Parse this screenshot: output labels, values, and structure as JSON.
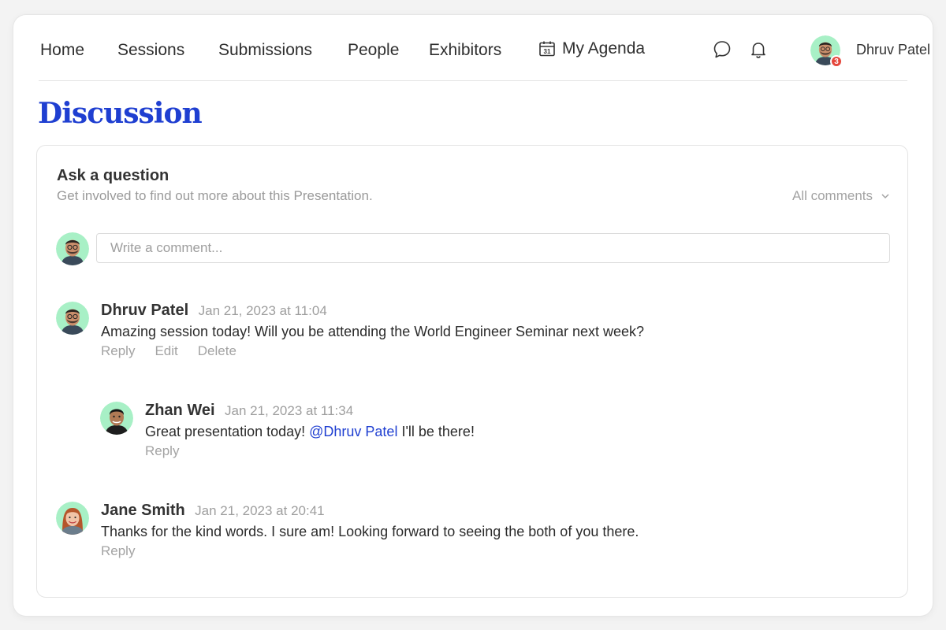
{
  "nav": {
    "links": [
      "Home",
      "Sessions",
      "Submissions",
      "People",
      "Exhibitors"
    ],
    "agenda_label": "My Agenda",
    "agenda_icon": "calendar-icon",
    "agenda_icon_day": "31",
    "chat_icon": "chat-bubble-icon",
    "bell_icon": "bell-icon",
    "notification_count": "3",
    "user_name": "Dhruv Patel"
  },
  "page": {
    "title": "Discussion"
  },
  "discussion": {
    "title": "Ask a question",
    "subtitle": "Get involved to find out more about this Presentation.",
    "filter_label": "All comments",
    "composer": {
      "placeholder": "Write a comment...",
      "value": ""
    },
    "comments": [
      {
        "author": "Dhruv Patel",
        "time": "Jan 21, 2023 at 11:04",
        "body": "Amazing session today! Will you be attending the World Engineer Seminar next week?",
        "actions": [
          "Reply",
          "Edit",
          "Delete"
        ]
      },
      {
        "author": "Zhan Wei",
        "time": "Jan 21, 2023 at 11:34",
        "body_before": "Great presentation today! ",
        "mention": "@Dhruv Patel",
        "body_after": " I'll be there!",
        "actions": [
          "Reply"
        ]
      },
      {
        "author": "Jane Smith",
        "time": "Jan 21, 2023 at 20:41",
        "body": "Thanks for the kind words. I sure am! Looking forward to seeing the both of you there.",
        "actions": [
          "Reply"
        ]
      }
    ]
  },
  "colors": {
    "accent": "#1f3fd1",
    "avatar_bg": "#a8f0c6",
    "badge": "#e5473c"
  }
}
